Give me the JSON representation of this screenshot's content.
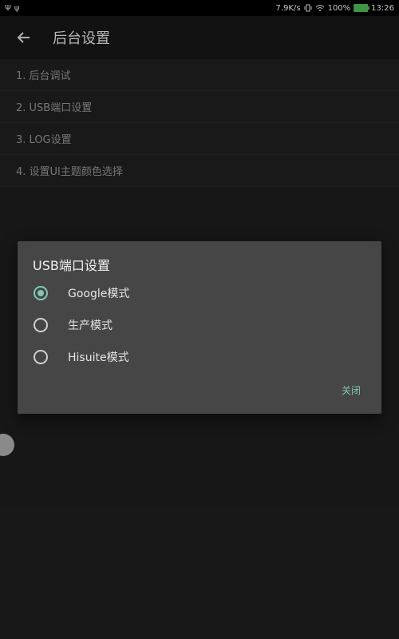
{
  "status_bar": {
    "net_speed": "7.9K/s",
    "battery": "100%",
    "time": "13:26",
    "battery_color": "#4caf50"
  },
  "app_bar": {
    "title": "后台设置"
  },
  "menu": {
    "items": [
      {
        "label": "1. 后台调试"
      },
      {
        "label": "2. USB端口设置"
      },
      {
        "label": "3. LOG设置"
      },
      {
        "label": "4. 设置UI主题颜色选择"
      }
    ]
  },
  "dialog": {
    "title": "USB端口设置",
    "options": [
      {
        "label": "Google模式",
        "selected": true
      },
      {
        "label": "生产模式",
        "selected": false
      },
      {
        "label": "Hisuite模式",
        "selected": false
      }
    ],
    "close_label": "关闭",
    "accent_color": "#7fc8b4"
  }
}
